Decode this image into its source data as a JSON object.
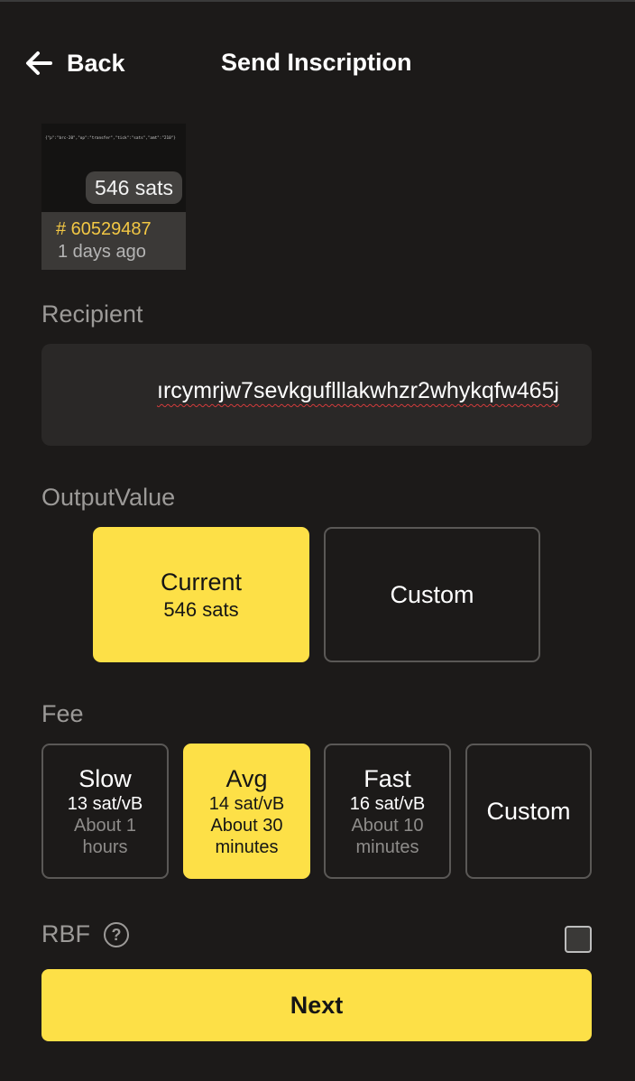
{
  "header": {
    "back_label": "Back",
    "title": "Send Inscription"
  },
  "inscription": {
    "preview_text": "{\"p\":\"brc-20\",\"op\":\"transfer\",\"tick\":\"sats\",\"amt\":\"210\"}",
    "value_badge": "546 sats",
    "number": "# 60529487",
    "date": "1 days ago"
  },
  "recipient": {
    "label": "Recipient",
    "value": "ırcymrjw7sevkguflllakwhzr2whykqfw465j"
  },
  "output_value": {
    "label": "OutputValue",
    "options": [
      {
        "title": "Current",
        "subtitle": "546 sats",
        "selected": true
      },
      {
        "title": "Custom",
        "selected": false
      }
    ]
  },
  "fee": {
    "label": "Fee",
    "options": [
      {
        "title": "Slow",
        "rate": "13 sat/vB",
        "time_line1": "About 1",
        "time_line2": "hours",
        "selected": false
      },
      {
        "title": "Avg",
        "rate": "14 sat/vB",
        "time_line1": "About 30",
        "time_line2": "minutes",
        "selected": true
      },
      {
        "title": "Fast",
        "rate": "16 sat/vB",
        "time_line1": "About 10",
        "time_line2": "minutes",
        "selected": false
      },
      {
        "title": "Custom",
        "selected": false
      }
    ]
  },
  "rbf": {
    "label": "RBF",
    "help_icon": "question-circle-icon",
    "help_glyph": "?",
    "checked": false
  },
  "next_label": "Next",
  "colors": {
    "accent": "#fde047",
    "background": "#1c1a19",
    "inscription_number": "#f2c744"
  }
}
